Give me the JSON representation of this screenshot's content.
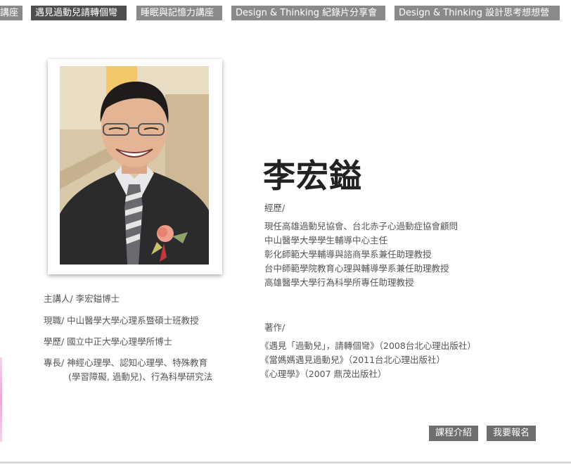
{
  "nav": {
    "tabs": [
      {
        "label": "講座",
        "active": false
      },
      {
        "label": "遇見過動兒請轉個彎",
        "active": true
      },
      {
        "label": "睡眠與記憶力講座",
        "active": false
      },
      {
        "label": "Design & Thinking 紀錄片分享會",
        "active": false
      },
      {
        "label": "Design & Thinking 設計思考想想營",
        "active": false
      }
    ]
  },
  "speaker": {
    "name": "李宏鎰",
    "photo_icon": "speaker-portrait"
  },
  "info": {
    "presenter": "主講人/ 李宏鎰博士",
    "current_job": "現職/ 中山醫學大學心理系暨碩士班教授",
    "education": "學歷/ 國立中正大學心理學所博士",
    "specialty_line1": "專長/ 神經心理學、認知心理學、特殊教育",
    "specialty_line2": "(學習障礙, 過動兒)、行為科學研究法"
  },
  "experience": {
    "label": "經歷/",
    "items": [
      "現任高雄過動兒協會、台北赤子心過動症協會顧問",
      "中山醫學大學學生輔導中心主任",
      "彰化師範大學輔導與諮商學系兼任助理教授",
      "台中師範學院教育心理與輔導學系兼任助理教授",
      "高雄醫學大學行為科學所專任助理教授"
    ]
  },
  "publications": {
    "label": "著作/",
    "items": [
      "《遇見「過動兒」，請轉個彎》（2008台北心理出版社）",
      "《當媽媽遇見過動兒》（2011台北心理出版社）",
      "《心理學》（2007 鼎茂出版社）"
    ]
  },
  "buttons": {
    "course_intro": "課程介紹",
    "register": "我要報名"
  },
  "colors": {
    "tab_bg": "#8a8a8a",
    "tab_active_bg": "#4f4f4f",
    "button_bg": "#6e6e6e"
  }
}
